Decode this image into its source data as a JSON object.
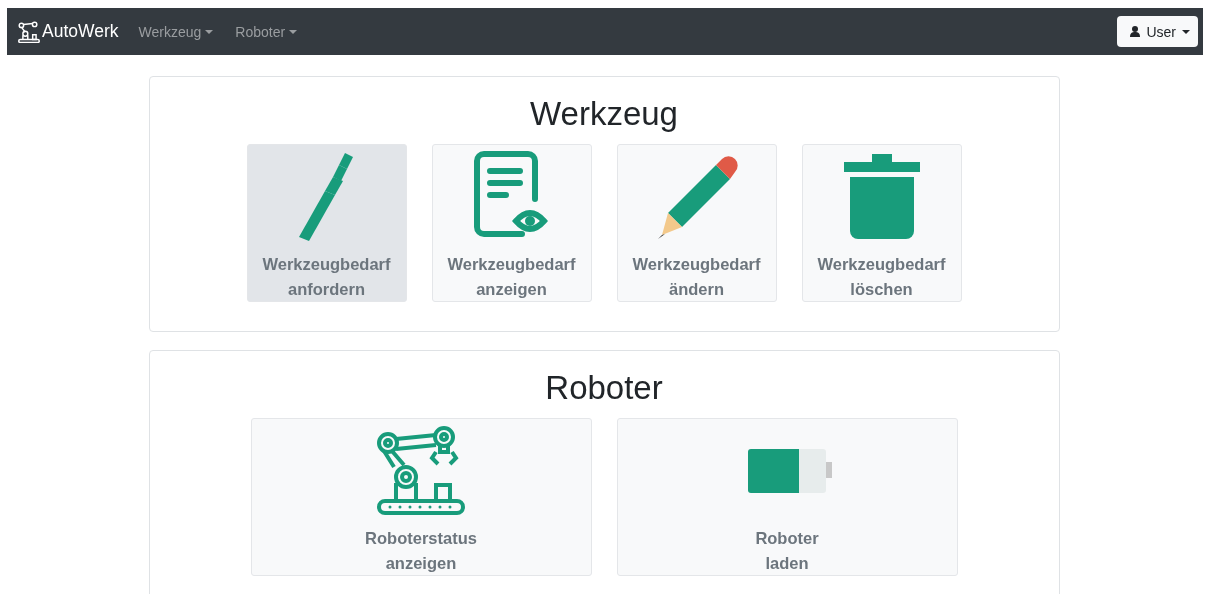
{
  "navbar": {
    "brand": "AutoWerk",
    "menus": [
      {
        "label": "Werkzeug"
      },
      {
        "label": "Roboter"
      }
    ],
    "user_button": "User"
  },
  "sections": [
    {
      "title": "Werkzeug",
      "tiles": [
        {
          "label": "Werkzeugbedarf\nanfordern",
          "selected": true
        },
        {
          "label": "Werkzeugbedarf\nanzeigen",
          "selected": false
        },
        {
          "label": "Werkzeugbedarf\nändern",
          "selected": false
        },
        {
          "label": "Werkzeugbedarf\nlöschen",
          "selected": false
        }
      ]
    },
    {
      "title": "Roboter",
      "tiles": [
        {
          "label": "Roboterstatus\nanzeigen",
          "selected": false
        },
        {
          "label": "Roboter\nladen",
          "selected": false
        }
      ]
    }
  ]
}
